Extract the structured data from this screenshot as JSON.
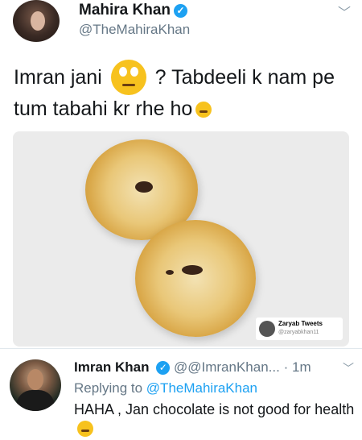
{
  "tweet": {
    "author_name": "Mahira Khan",
    "author_handle": "@TheMahiraKhan",
    "text_part1": "Imran jani",
    "text_part2": "? Tabdeeli k nam pe tum tabahi kr rhe ho",
    "icons": [
      "verified-badge-icon",
      "chevron-down-icon",
      "rolling-eyes-emoji-icon",
      "grimace-emoji-icon"
    ]
  },
  "watermark": {
    "name": "Zaryab Tweets",
    "handle": "@zaryabkhan11"
  },
  "reply": {
    "author_name": "Imran Khan",
    "author_handle": "@@ImranKhan...",
    "separator": "·",
    "time": "1m",
    "replying_prefix": "Replying to",
    "replying_to": "@TheMahiraKhan",
    "text": "HAHA , Jan chocolate is not good for health",
    "icons": [
      "verified-badge-icon",
      "chevron-down-icon",
      "smile-emoji-icon"
    ]
  },
  "colors": {
    "link": "#1da1f2",
    "secondary_text": "#657786",
    "verified": "#1da1f2"
  }
}
